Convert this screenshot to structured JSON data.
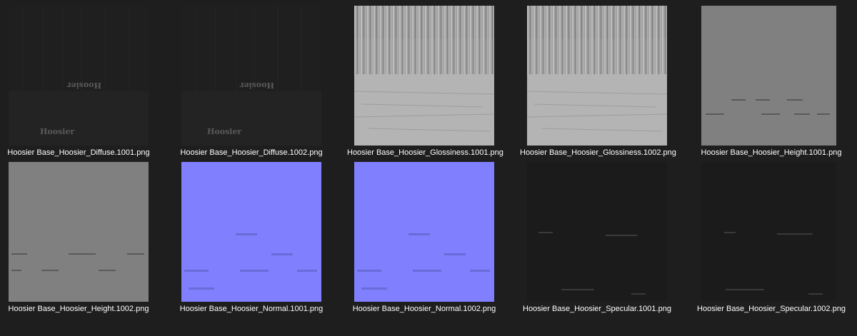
{
  "file_browser": {
    "items": [
      {
        "label": "Hoosier Base_Hoosier_Diffuse.1001.png",
        "kind": "diffuse",
        "variant": "1001",
        "thumb_color": "#202020"
      },
      {
        "label": "Hoosier Base_Hoosier_Diffuse.1002.png",
        "kind": "diffuse",
        "variant": "1002",
        "thumb_color": "#202020"
      },
      {
        "label": "Hoosier Base_Hoosier_Glossiness.1001.png",
        "kind": "glossiness",
        "variant": "1001",
        "thumb_color": "#a8a8a8"
      },
      {
        "label": "Hoosier Base_Hoosier_Glossiness.1002.png",
        "kind": "glossiness",
        "variant": "1002",
        "thumb_color": "#a8a8a8"
      },
      {
        "label": "Hoosier Base_Hoosier_Height.1001.png",
        "kind": "height",
        "variant": "1001",
        "thumb_color": "#808080"
      },
      {
        "label": "Hoosier Base_Hoosier_Height.1002.png",
        "kind": "height",
        "variant": "1002",
        "thumb_color": "#808080"
      },
      {
        "label": "Hoosier Base_Hoosier_Normal.1001.png",
        "kind": "normal",
        "variant": "1001",
        "thumb_color": "#8080ff"
      },
      {
        "label": "Hoosier Base_Hoosier_Normal.1002.png",
        "kind": "normal",
        "variant": "1002",
        "thumb_color": "#8080ff"
      },
      {
        "label": "Hoosier Base_Hoosier_Specular.1001.png",
        "kind": "specular",
        "variant": "1001",
        "thumb_color": "#1c1c1c"
      },
      {
        "label": "Hoosier Base_Hoosier_Specular.1002.png",
        "kind": "specular",
        "variant": "1002",
        "thumb_color": "#1c1c1c"
      }
    ]
  },
  "thumbnail_text": {
    "diffuse_mirrored": "Hoosier",
    "diffuse": "Hoosier"
  },
  "colors": {
    "background": "#1e1e1e",
    "caption_text": "#ffffff"
  }
}
